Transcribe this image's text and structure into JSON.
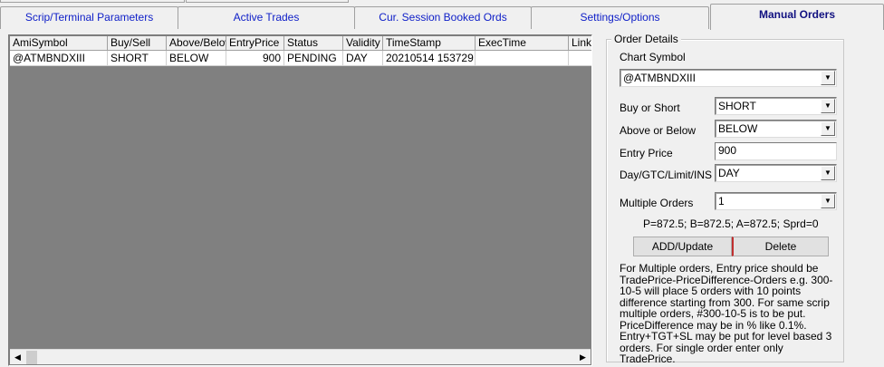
{
  "tabs": [
    {
      "label": "Scrip/Terminal Parameters"
    },
    {
      "label": "Active Trades"
    },
    {
      "label": "Cur. Session Booked Ords"
    },
    {
      "label": "Settings/Options"
    },
    {
      "label": "Manual Orders",
      "active": true
    }
  ],
  "grid": {
    "columns": [
      "AmiSymbol",
      "Buy/Sell",
      "Above/Below",
      "EntryPrice",
      "Status",
      "Validity",
      "TimeStamp",
      "ExecTime",
      "Link"
    ],
    "rows": [
      [
        "@ATMBNDXIII",
        "SHORT",
        "BELOW",
        "900",
        "PENDING",
        "DAY",
        "20210514 153729",
        "",
        ""
      ]
    ]
  },
  "order_details": {
    "title": "Order Details",
    "chart_symbol_label": "Chart Symbol",
    "chart_symbol_value": "@ATMBNDXIII",
    "buy_short_label": "Buy or Short",
    "buy_short_value": "SHORT",
    "above_below_label": "Above or Below",
    "above_below_value": "BELOW",
    "entry_price_label": "Entry Price",
    "entry_price_value": "900",
    "day_gtc_label": "Day/GTC/Limit/INS",
    "day_gtc_value": "DAY",
    "multiple_orders_label": "Multiple Orders",
    "multiple_orders_value": "1",
    "price_info": "P=872.5;  B=872.5;  A=872.5;  Sprd=0",
    "add_button": "ADD/Update",
    "delete_button": "Delete",
    "note": "For Multiple orders, Entry price should be TradePrice-PriceDifference-Orders e.g. 300-10-5 will place 5 orders with 10 points difference starting from 300. For same scrip multiple orders, #300-10-5 is to be put. PriceDifference may be in % like 0.1%. Entry+TGT+SL may be put for level based 3 orders. For single order enter only TradePrice."
  },
  "icons": {
    "dropdown": "chevron-down-icon",
    "scroll_left": "arrow-left-icon",
    "scroll_right": "arrow-right-icon"
  }
}
